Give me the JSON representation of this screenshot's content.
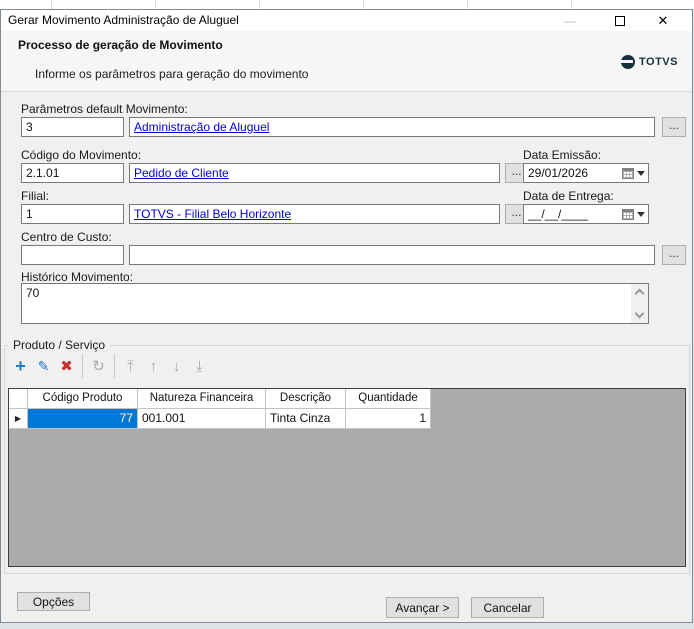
{
  "window": {
    "title": "Gerar Movimento Administração de Aluguel"
  },
  "ui": {
    "browse": "...",
    "row_marker": "▶",
    "minimize_glyph": "—",
    "close_glyph": "✕"
  },
  "header": {
    "title": "Processo de geração de Movimento",
    "subtitle": "Informe os parâmetros para geração do movimento",
    "brand": "TOTVS"
  },
  "form": {
    "parametros": {
      "label": "Parâmetros default Movimento:",
      "code": "3",
      "description": "Administração de Aluguel"
    },
    "codigo_movimento": {
      "label": "Código do Movimento:",
      "code": "2.1.01",
      "description": "Pedido de Cliente"
    },
    "data_emissao": {
      "label": "Data Emissão:",
      "value": "29/01/2026"
    },
    "filial": {
      "label": "Filial:",
      "code": "1",
      "description": "TOTVS - Filial Belo Horizonte"
    },
    "data_entrega": {
      "label": "Data de Entrega:",
      "value": "__/__/____"
    },
    "centro_custo": {
      "label": "Centro de Custo:",
      "code": "",
      "description": ""
    },
    "historico": {
      "label": "Histórico Movimento:",
      "value": "70"
    }
  },
  "produto_servico": {
    "legend": "Produto / Serviço",
    "toolbar": [
      {
        "name": "add",
        "glyph": "+",
        "enabled": true
      },
      {
        "name": "edit",
        "glyph": "✎",
        "enabled": true
      },
      {
        "name": "delete",
        "glyph": "✖",
        "enabled": true
      },
      {
        "name": "refresh",
        "glyph": "↻",
        "enabled": false
      },
      {
        "name": "move-first",
        "glyph": "⤒",
        "enabled": false
      },
      {
        "name": "move-up",
        "glyph": "↑",
        "enabled": false
      },
      {
        "name": "move-down",
        "glyph": "↓",
        "enabled": false
      },
      {
        "name": "move-last",
        "glyph": "⤓",
        "enabled": false
      }
    ],
    "grid": {
      "columns": [
        "Código Produto",
        "Natureza Financeira",
        "Descrição",
        "Quantidade"
      ],
      "rows": [
        {
          "codigo": "77",
          "natureza": "001.001",
          "descricao": "Tinta Cinza",
          "quantidade": "1"
        }
      ]
    }
  },
  "footer": {
    "options_label": "Opções",
    "next_label": "Avançar >",
    "cancel_label": "Cancelar"
  },
  "colors": {
    "selection_blue": "#0078d7",
    "link_blue": "#0000dd",
    "icon_blue": "#2578be",
    "icon_red": "#c53030",
    "icon_gray": "#a9a9a9",
    "brand_navy": "#16303d",
    "grid_area_gray": "#ababab"
  }
}
